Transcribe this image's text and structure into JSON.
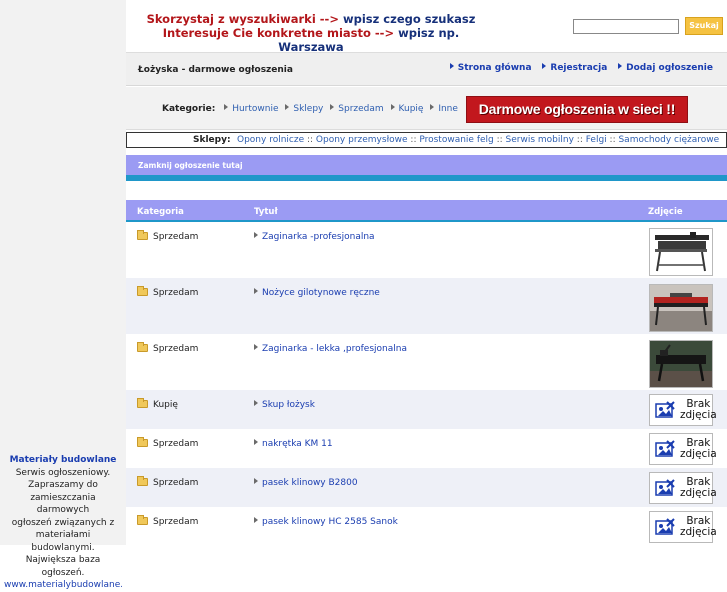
{
  "sidebar": {
    "ad_title": "Materiały budowlane",
    "ad_lines": [
      "Serwis ogłoszeniowy.",
      "Zapraszamy do",
      "zamieszczania darmowych",
      "ogłoszeń związanych z",
      "materiałami budowlanymi.",
      "Największa baza ogłoszeń."
    ],
    "ad_url": "www.materialybudowlane.com"
  },
  "banner": {
    "line1_a": "Skorzystaj z wyszukiwarki --> ",
    "line1_b": "wpisz czego szukasz",
    "line2_a": "Interesuje Cie konkretne miasto --> ",
    "line2_b": "wpisz np. Warszawa",
    "search_value": "",
    "search_button": "Szukaj"
  },
  "titlebar": {
    "page_title": "Łożyska - darmowe ogłoszenia",
    "nav": [
      "Strona główna",
      "Rejestracja",
      "Dodaj ogłoszenie"
    ]
  },
  "categories": {
    "label": "Kategorie:",
    "items": [
      "Hurtownie",
      "Sklepy",
      "Sprzedam",
      "Kupię",
      "Inne"
    ],
    "ad_banner": "Darmowe ogłoszenia w sieci !!"
  },
  "shops": {
    "label": "Sklepy:",
    "items": [
      "Opony rolnicze",
      "Opony przemysłowe",
      "Prostowanie felg",
      "Serwis mobilny",
      "Felgi",
      "Samochody ciężarowe"
    ]
  },
  "login": {
    "text": "Zamknij ogłoszenie tutaj"
  },
  "listing": {
    "headers": {
      "category": "Kategoria",
      "title": "Tytuł",
      "photo": "Zdjęcie"
    },
    "rows": [
      {
        "category": "Sprzedam",
        "title": "Zaginarka -profesjonalna",
        "photo": "image"
      },
      {
        "category": "Sprzedam",
        "title": "Nożyce gilotynowe ręczne",
        "photo": "image"
      },
      {
        "category": "Sprzedam",
        "title": "Zaginarka - lekka ,profesjonalna",
        "photo": "image"
      },
      {
        "category": "Kupię",
        "title": "Skup łożysk",
        "photo": "none"
      },
      {
        "category": "Sprzedam",
        "title": "nakrętka KM 11",
        "photo": "none"
      },
      {
        "category": "Sprzedam",
        "title": "pasek klinowy B2800",
        "photo": "none"
      },
      {
        "category": "Sprzedam",
        "title": "pasek klinowy HC 2585 Sanok",
        "photo": "none"
      }
    ],
    "no_photo_line1": "Brak",
    "no_photo_line2": "zdjęcia"
  },
  "colors": {
    "header_purple": "#9b9bf3",
    "accent_blue": "#1f97c9",
    "link_blue": "#1a3db0",
    "ad_red": "#c2171d",
    "search_button": "#f5c241"
  }
}
